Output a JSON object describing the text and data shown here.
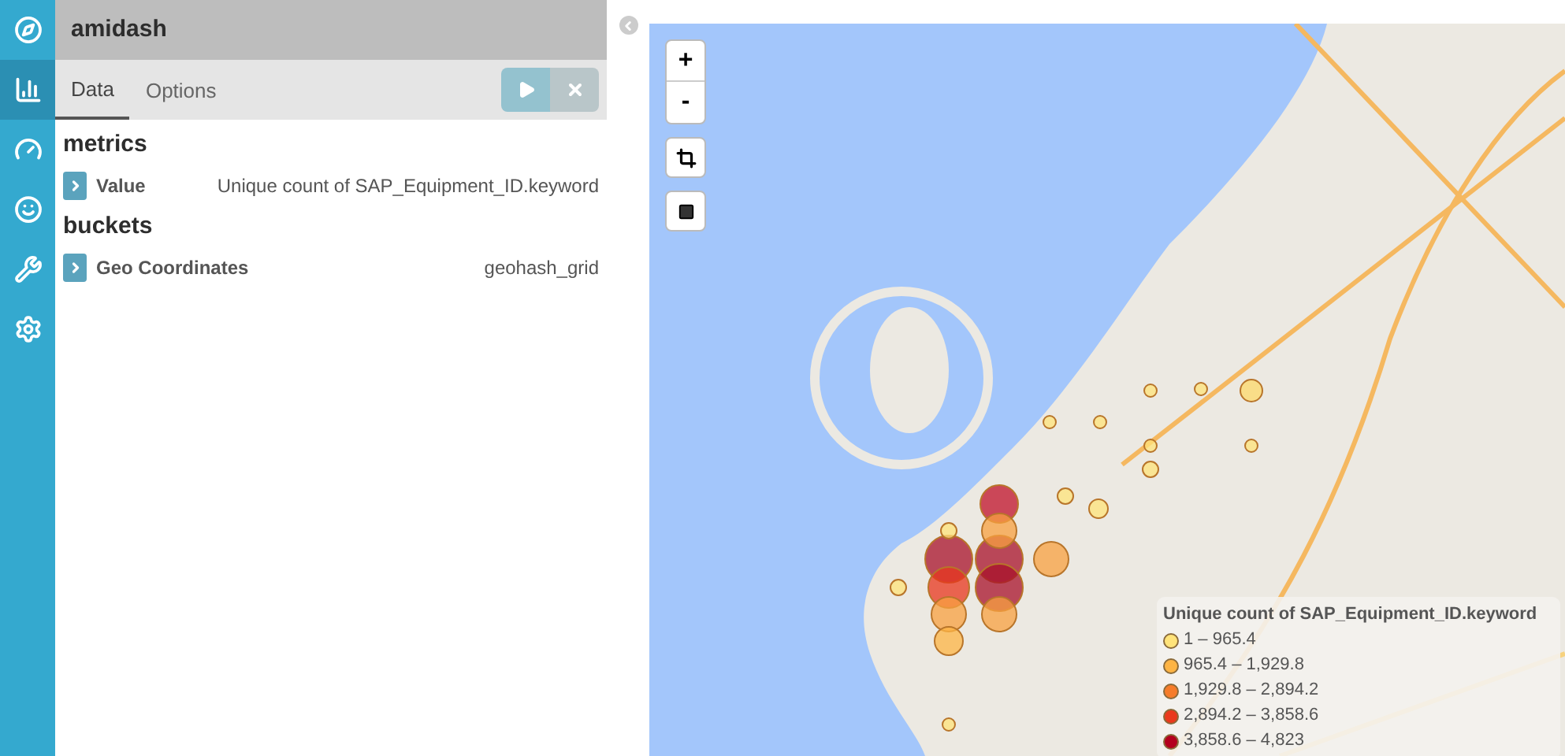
{
  "nav": [
    {
      "kind": "discover",
      "selected": false
    },
    {
      "kind": "visualize",
      "selected": true
    },
    {
      "kind": "dashboard",
      "selected": false
    },
    {
      "kind": "timelion",
      "selected": false
    },
    {
      "kind": "devtools",
      "selected": false
    },
    {
      "kind": "management",
      "selected": false
    }
  ],
  "title": "amidash",
  "tabs": [
    {
      "label": "Data",
      "selected": true
    },
    {
      "label": "Options",
      "selected": false
    }
  ],
  "sections": [
    {
      "heading": "metrics",
      "rows": [
        {
          "label": "Value",
          "value": "Unique count of SAP_Equipment_ID.keyword"
        }
      ]
    },
    {
      "heading": "buckets",
      "rows": [
        {
          "label": "Geo Coordinates",
          "value": "geohash_grid"
        }
      ]
    }
  ],
  "map_controls": [
    "+",
    "-"
  ],
  "legend": {
    "title": "Unique count of SAP_Equipment_ID.keyword",
    "items": [
      {
        "label": "1 – 965.4",
        "color": "#ffe37a"
      },
      {
        "label": "965.4 – 1,929.8",
        "color": "#fdb444"
      },
      {
        "label": "1,929.8 – 2,894.2",
        "color": "#f67c2a"
      },
      {
        "label": "2,894.2 – 3,858.6",
        "color": "#ea3a1d"
      },
      {
        "label": "3,858.6 – 4,823",
        "color": "#b4001e"
      }
    ]
  }
}
